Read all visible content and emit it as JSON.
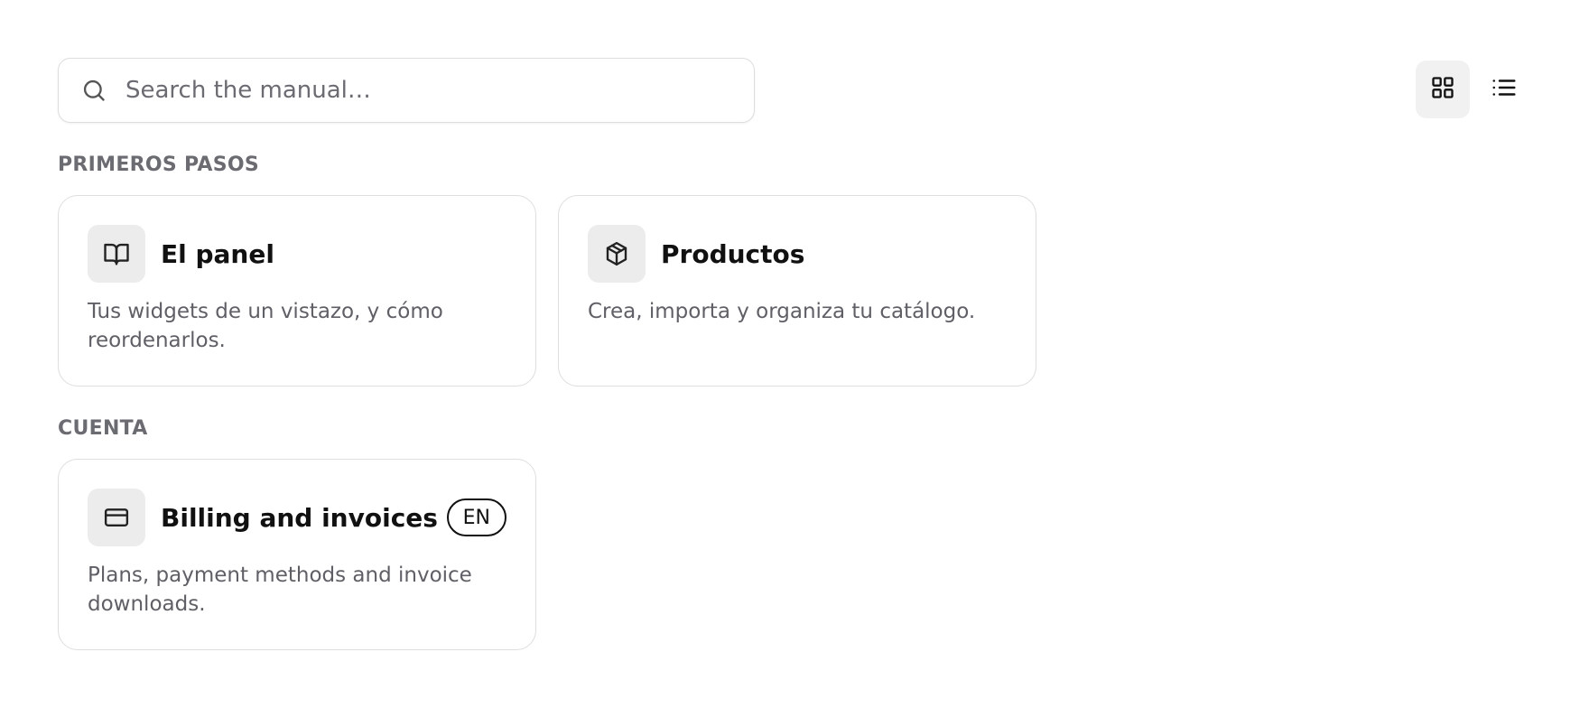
{
  "search": {
    "placeholder": "Search the manual…",
    "value": ""
  },
  "view_toggle": {
    "grid_icon": "grid-icon",
    "list_icon": "list-icon",
    "active": "grid"
  },
  "sections": [
    {
      "title": "PRIMEROS PASOS",
      "cards": [
        {
          "icon": "book-icon",
          "title": "El panel",
          "description": "Tus widgets de un vistazo, y cómo reordenarlos."
        },
        {
          "icon": "box-icon",
          "title": "Productos",
          "description": "Crea, importa y organiza tu catálogo."
        }
      ]
    },
    {
      "title": "CUENTA",
      "cards": [
        {
          "icon": "credit-card-icon",
          "title": "Billing and invoices",
          "badge": "EN",
          "description": "Plans, payment methods and invoice downloads."
        }
      ]
    }
  ],
  "colors": {
    "muted_text": "#6b6b72",
    "description_text": "#5f5f66",
    "card_border": "#dedede",
    "icon_tile": "#ececec",
    "active_toggle": "#f1f1f2"
  }
}
